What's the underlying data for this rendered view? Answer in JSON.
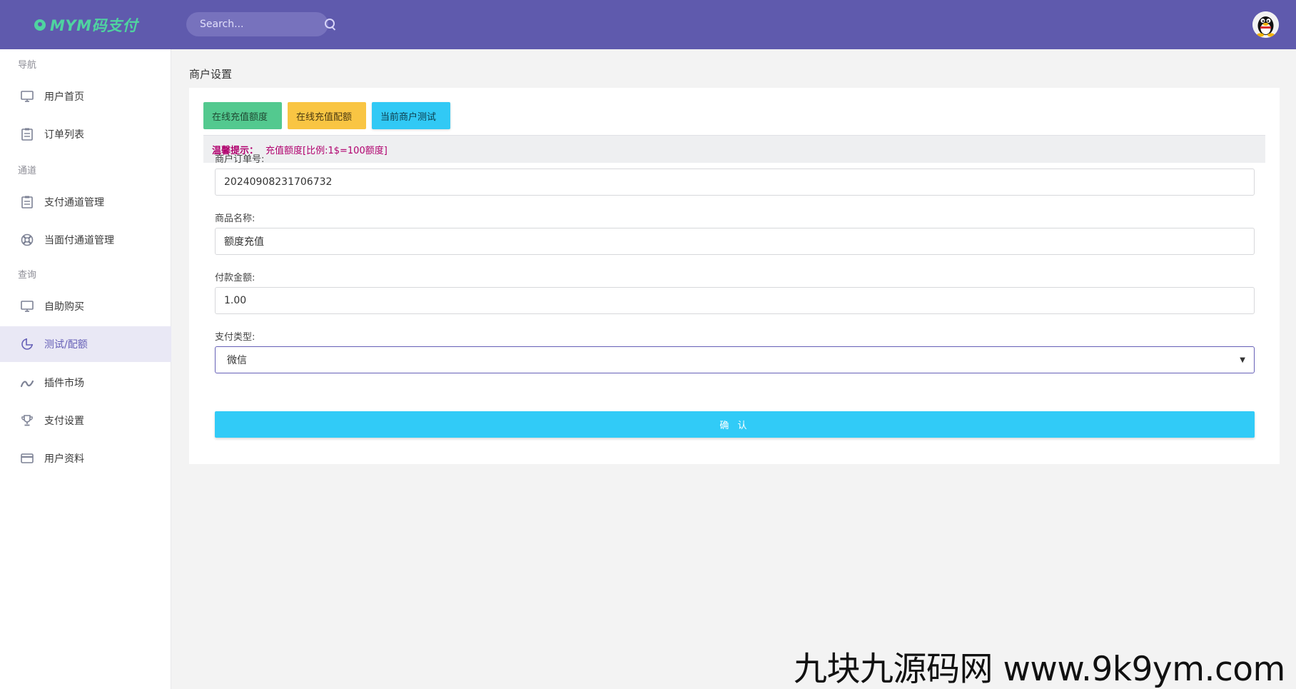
{
  "app": {
    "title": "MYM码支付"
  },
  "search": {
    "placeholder": "Search..."
  },
  "sidebar": {
    "sections": [
      {
        "label": "导航"
      },
      {
        "label": "通道"
      },
      {
        "label": "查询"
      }
    ],
    "items": [
      {
        "label": "用户首页",
        "icon": "monitor-icon"
      },
      {
        "label": "订单列表",
        "icon": "clipboard-icon"
      },
      {
        "label": "支付通道管理",
        "icon": "clipboard-icon"
      },
      {
        "label": "当面付通道管理",
        "icon": "lifebuoy-icon"
      },
      {
        "label": "自助购买",
        "icon": "monitor-icon"
      },
      {
        "label": "测试/配额",
        "icon": "pie-chart-icon",
        "active": true
      },
      {
        "label": "插件市场",
        "icon": "wave-icon"
      },
      {
        "label": "支付设置",
        "icon": "trophy-icon"
      },
      {
        "label": "用户资料",
        "icon": "card-icon"
      }
    ]
  },
  "page": {
    "title": "商户设置"
  },
  "tabs": [
    {
      "label": "在线充值额度",
      "color": "#53c98f"
    },
    {
      "label": "在线充值配额",
      "color": "#f9c543"
    },
    {
      "label": "当前商户测试",
      "color": "#31c9f5"
    }
  ],
  "notice": {
    "prefix": "温馨提示：",
    "text": "充值额度[比例:1$=100额度]"
  },
  "form": {
    "order_no": {
      "label": "商户订单号:",
      "value": "20240908231706732"
    },
    "product": {
      "label": "商品名称:",
      "value": "额度充值"
    },
    "amount": {
      "label": "付款金额:",
      "value": "1.00"
    },
    "pay_type": {
      "label": "支付类型:",
      "value": "微信"
    },
    "submit_label": "确 认"
  },
  "watermark": {
    "text": "九块九源码网 www.9k9ym.com"
  },
  "colors": {
    "topbar": "#5f5aad",
    "accent": "#6660b7",
    "submit": "#31cbf7",
    "notice_text": "#b0006d"
  }
}
